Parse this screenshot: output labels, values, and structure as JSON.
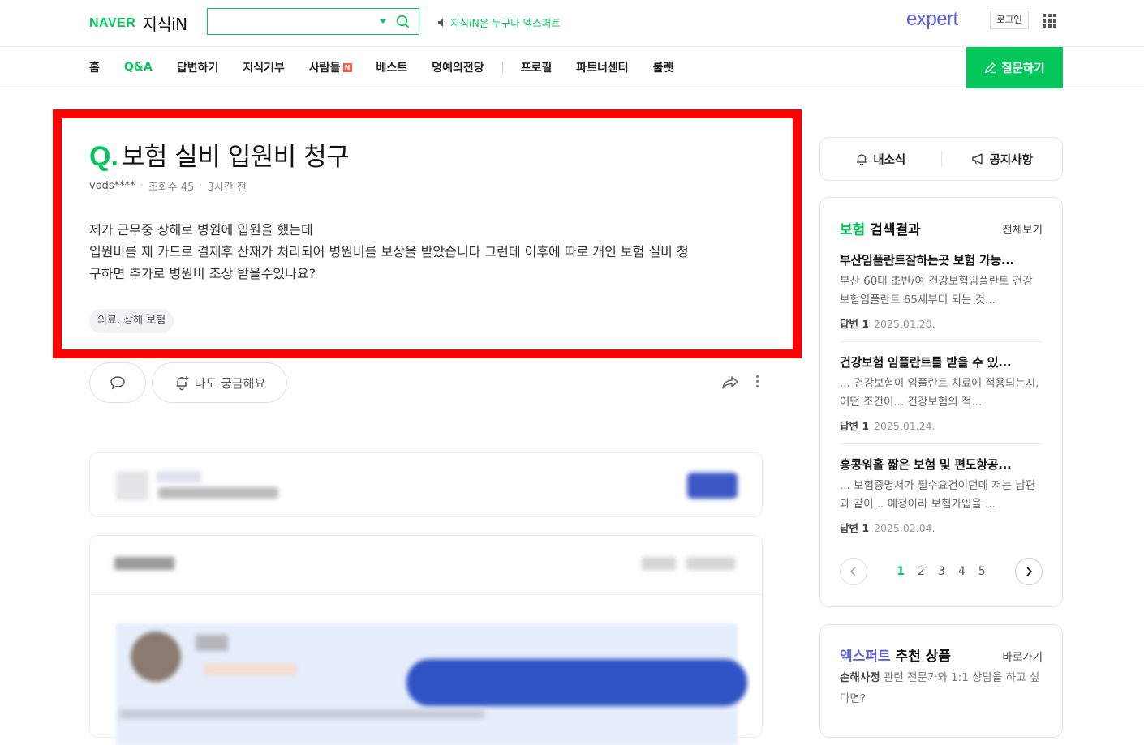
{
  "header": {
    "logo_naver": "NAVER",
    "logo_service": "지식iN",
    "notice": "지식iN은 누구나 엑스퍼트",
    "expert_logo": "expert",
    "login": "로그인"
  },
  "nav": {
    "items": [
      {
        "label": "홈"
      },
      {
        "label": "Q&A",
        "active": true
      },
      {
        "label": "답변하기"
      },
      {
        "label": "지식기부"
      },
      {
        "label": "사람들",
        "badge": "N"
      },
      {
        "label": "베스트"
      },
      {
        "label": "명예의전당"
      },
      {
        "label": "프로필"
      },
      {
        "label": "파트너센터"
      },
      {
        "label": "룰렛"
      }
    ],
    "ask_button": "질문하기"
  },
  "question": {
    "q_mark": "Q.",
    "title": "보험 실비 입원비 청구",
    "author": "vods****",
    "views": "조회수 45",
    "time": "3시간 전",
    "body_lines": [
      "제가 근무중 상해로 병원에 입원을 했는데",
      "입원비를 제 카드로 결제후 산재가 처리되어 병원비를 보상을 받았습니다 그런데 이후에 따로 개인 보험 실비 청",
      "구하면 추가로 병원비 조상 받을수있나요?"
    ],
    "tag": "의료, 상해 보험",
    "curious_button": "나도 궁금해요"
  },
  "sidebar": {
    "my_news": "내소식",
    "notices": "공지사항",
    "search_result": {
      "keyword": "보험",
      "title_suffix": "검색결과",
      "view_all": "전체보기",
      "items": [
        {
          "title": "부산임플란트잘하는곳 보험 가능...",
          "desc": "부산 60대 초반/여 건강보험임플란트 건강보험임플란트 65세부터 되는 것...",
          "answers_label": "답변 1",
          "date": "2025.01.20."
        },
        {
          "title": "건강보험 임플란트를 받을 수 있...",
          "desc": "... 건강보험이 임플란트 치료에 적용되는지, 어떤 조건이... 건강보험의 적...",
          "answers_label": "답변 1",
          "date": "2025.01.24."
        },
        {
          "title": "홍콩워홀 짧은 보험 및 편도항공...",
          "desc": "... 보험증명서가 필수요건이던데 저는 남편과 같이... 예정이라 보험가입을 ...",
          "answers_label": "답변 1",
          "date": "2025.02.04."
        }
      ],
      "pages": [
        "1",
        "2",
        "3",
        "4",
        "5"
      ],
      "current_page": "1"
    },
    "expert": {
      "keyword": "엑스퍼트",
      "title_suffix": "추천 상품",
      "go": "바로가기",
      "desc_bold": "손해사정",
      "desc_rest": " 관련 전문가와 1:1 상담을 하고 싶다면?"
    }
  },
  "colors": {
    "naver_green": "#03c75a",
    "expert_purple": "#5a5ee0",
    "highlight_red": "#ff0000"
  }
}
